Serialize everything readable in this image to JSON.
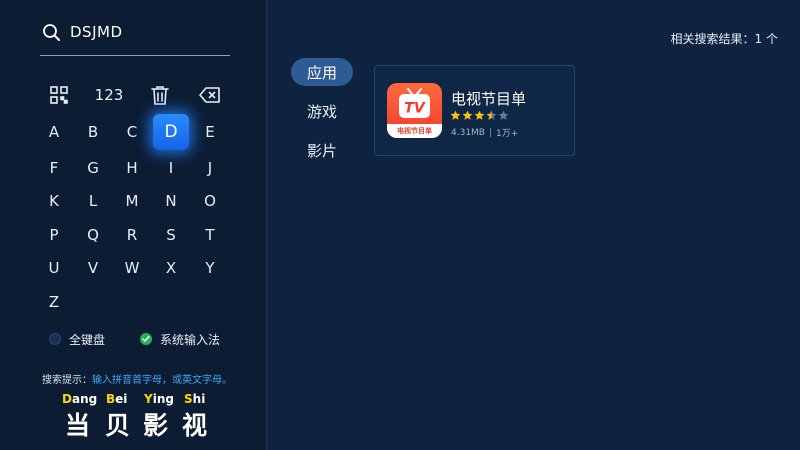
{
  "search": {
    "query": "DSJMD"
  },
  "keyboard": {
    "fn_keys": {
      "qr": "qr-code-icon",
      "numeric": "123",
      "clear": "trash-icon",
      "backspace": "backspace-icon"
    },
    "rows": [
      [
        "A",
        "B",
        "C",
        "D",
        "E"
      ],
      [
        "F",
        "G",
        "H",
        "I",
        "J"
      ],
      [
        "K",
        "L",
        "M",
        "N",
        "O"
      ],
      [
        "P",
        "Q",
        "R",
        "S",
        "T"
      ],
      [
        "U",
        "V",
        "W",
        "X",
        "Y"
      ],
      [
        "Z"
      ]
    ],
    "focused_key": "D"
  },
  "input_modes": {
    "full_keyboard": {
      "label": "全键盘",
      "selected": false
    },
    "system_ime": {
      "label": "系统输入法",
      "selected": true
    }
  },
  "hint": {
    "prefix": "搜索提示：",
    "body": "输入拼音首字母，或英文字母。"
  },
  "brand": {
    "pinyin": [
      {
        "initial": "D",
        "rest": "ang"
      },
      {
        "initial": "B",
        "rest": "ei"
      },
      {
        "initial": "Y",
        "rest": "ing"
      },
      {
        "initial": "S",
        "rest": "hi"
      }
    ],
    "hanzi": [
      "当",
      "贝",
      "影",
      "视"
    ]
  },
  "categories": [
    {
      "label": "应用",
      "active": true
    },
    {
      "label": "游戏",
      "active": false
    },
    {
      "label": "影片",
      "active": false
    }
  ],
  "result_count": "相关搜索结果：1 个",
  "results": [
    {
      "name": "电视节目单",
      "icon_text": "TV",
      "icon_banner": "电视节目单",
      "rating": 3.5,
      "size": "4.31MB",
      "downloads": "1万+"
    }
  ],
  "colors": {
    "accent": "#2b8cff",
    "star": "#ffc107",
    "star_empty": "#6b7a8f",
    "hint": "#3fa9f5",
    "brand_yellow": "#ffd600"
  }
}
